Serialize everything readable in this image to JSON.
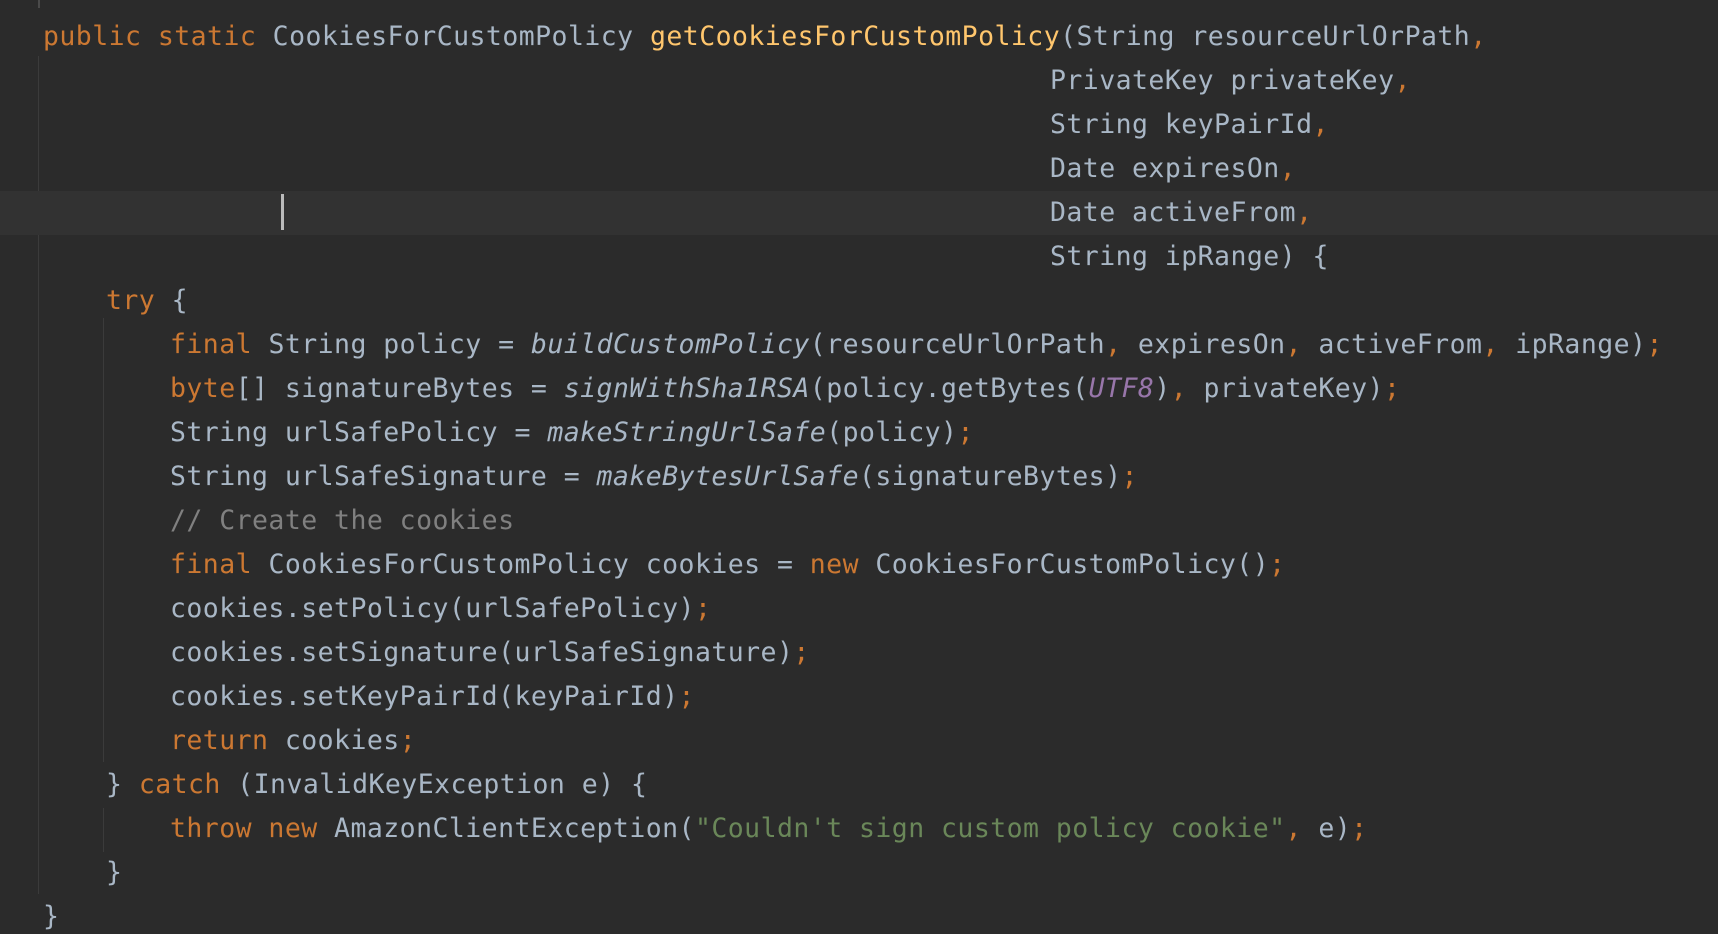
{
  "colors": {
    "background": "#2b2b2b",
    "current_line": "#323232",
    "keyword": "#cc7832",
    "plain": "#a9b7c6",
    "method_decl": "#ffc66d",
    "static_call": "#a9b7c6",
    "static_field": "#9876aa",
    "string": "#6a8759",
    "comment": "#808080",
    "punct": "#cc7832"
  },
  "lines": [
    {
      "indent": 43,
      "tokens": [
        {
          "t": "public static ",
          "c": "keyword"
        },
        {
          "t": "CookiesForCustomPolicy ",
          "c": "plain"
        },
        {
          "t": "getCookiesForCustomPolicy",
          "c": "method_decl"
        },
        {
          "t": "(String resourceUrlOrPath",
          "c": "plain"
        },
        {
          "t": ",",
          "c": "punct"
        }
      ]
    },
    {
      "indent": 1050,
      "tokens": [
        {
          "t": "PrivateKey privateKey",
          "c": "plain"
        },
        {
          "t": ",",
          "c": "punct"
        }
      ]
    },
    {
      "indent": 1050,
      "tokens": [
        {
          "t": "String keyPairId",
          "c": "plain"
        },
        {
          "t": ",",
          "c": "punct"
        }
      ]
    },
    {
      "indent": 1050,
      "tokens": [
        {
          "t": "Date expiresOn",
          "c": "plain"
        },
        {
          "t": ",",
          "c": "punct"
        }
      ]
    },
    {
      "indent": 1050,
      "current": true,
      "tokens": [
        {
          "t": "Date activeFrom",
          "c": "plain"
        },
        {
          "t": ",",
          "c": "punct"
        }
      ]
    },
    {
      "indent": 1050,
      "tokens": [
        {
          "t": "String ipRange) {",
          "c": "plain"
        }
      ]
    },
    {
      "indent": 106,
      "tokens": [
        {
          "t": "try ",
          "c": "keyword"
        },
        {
          "t": "{",
          "c": "plain"
        }
      ]
    },
    {
      "indent": 170,
      "tokens": [
        {
          "t": "final ",
          "c": "keyword"
        },
        {
          "t": "String policy = ",
          "c": "plain"
        },
        {
          "t": "buildCustomPolicy",
          "c": "static_call",
          "i": true
        },
        {
          "t": "(resourceUrlOrPath",
          "c": "plain"
        },
        {
          "t": ", ",
          "c": "punct"
        },
        {
          "t": "expiresOn",
          "c": "plain"
        },
        {
          "t": ", ",
          "c": "punct"
        },
        {
          "t": "activeFrom",
          "c": "plain"
        },
        {
          "t": ", ",
          "c": "punct"
        },
        {
          "t": "ipRange)",
          "c": "plain"
        },
        {
          "t": ";",
          "c": "punct"
        }
      ]
    },
    {
      "indent": 170,
      "tokens": [
        {
          "t": "byte",
          "c": "keyword"
        },
        {
          "t": "[] signatureBytes = ",
          "c": "plain"
        },
        {
          "t": "signWithSha1RSA",
          "c": "static_call",
          "i": true
        },
        {
          "t": "(policy.getBytes(",
          "c": "plain"
        },
        {
          "t": "UTF8",
          "c": "static_field",
          "i": true
        },
        {
          "t": ")",
          "c": "plain"
        },
        {
          "t": ", ",
          "c": "punct"
        },
        {
          "t": "privateKey)",
          "c": "plain"
        },
        {
          "t": ";",
          "c": "punct"
        }
      ]
    },
    {
      "indent": 170,
      "tokens": [
        {
          "t": "String urlSafePolicy = ",
          "c": "plain"
        },
        {
          "t": "makeStringUrlSafe",
          "c": "static_call",
          "i": true
        },
        {
          "t": "(policy)",
          "c": "plain"
        },
        {
          "t": ";",
          "c": "punct"
        }
      ]
    },
    {
      "indent": 170,
      "tokens": [
        {
          "t": "String urlSafeSignature = ",
          "c": "plain"
        },
        {
          "t": "makeBytesUrlSafe",
          "c": "static_call",
          "i": true
        },
        {
          "t": "(signatureBytes)",
          "c": "plain"
        },
        {
          "t": ";",
          "c": "punct"
        }
      ]
    },
    {
      "indent": 170,
      "tokens": [
        {
          "t": "// Create the cookies",
          "c": "comment"
        }
      ]
    },
    {
      "indent": 170,
      "tokens": [
        {
          "t": "final ",
          "c": "keyword"
        },
        {
          "t": "CookiesForCustomPolicy cookies = ",
          "c": "plain"
        },
        {
          "t": "new ",
          "c": "keyword"
        },
        {
          "t": "CookiesForCustomPolicy()",
          "c": "plain"
        },
        {
          "t": ";",
          "c": "punct"
        }
      ]
    },
    {
      "indent": 170,
      "tokens": [
        {
          "t": "cookies.setPolicy(urlSafePolicy)",
          "c": "plain"
        },
        {
          "t": ";",
          "c": "punct"
        }
      ]
    },
    {
      "indent": 170,
      "tokens": [
        {
          "t": "cookies.setSignature(urlSafeSignature)",
          "c": "plain"
        },
        {
          "t": ";",
          "c": "punct"
        }
      ]
    },
    {
      "indent": 170,
      "tokens": [
        {
          "t": "cookies.setKeyPairId(keyPairId)",
          "c": "plain"
        },
        {
          "t": ";",
          "c": "punct"
        }
      ]
    },
    {
      "indent": 170,
      "tokens": [
        {
          "t": "return ",
          "c": "keyword"
        },
        {
          "t": "cookies",
          "c": "plain"
        },
        {
          "t": ";",
          "c": "punct"
        }
      ]
    },
    {
      "indent": 106,
      "tokens": [
        {
          "t": "} ",
          "c": "plain"
        },
        {
          "t": "catch ",
          "c": "keyword"
        },
        {
          "t": "(InvalidKeyException e) {",
          "c": "plain"
        }
      ]
    },
    {
      "indent": 170,
      "tokens": [
        {
          "t": "throw new ",
          "c": "keyword"
        },
        {
          "t": "AmazonClientException(",
          "c": "plain"
        },
        {
          "t": "\"Couldn't sign custom policy cookie\"",
          "c": "string"
        },
        {
          "t": ", ",
          "c": "punct"
        },
        {
          "t": "e)",
          "c": "plain"
        },
        {
          "t": ";",
          "c": "punct"
        }
      ]
    },
    {
      "indent": 106,
      "tokens": [
        {
          "t": "}",
          "c": "plain"
        }
      ]
    },
    {
      "indent": 43,
      "tokens": [
        {
          "t": "}",
          "c": "plain"
        }
      ]
    }
  ]
}
